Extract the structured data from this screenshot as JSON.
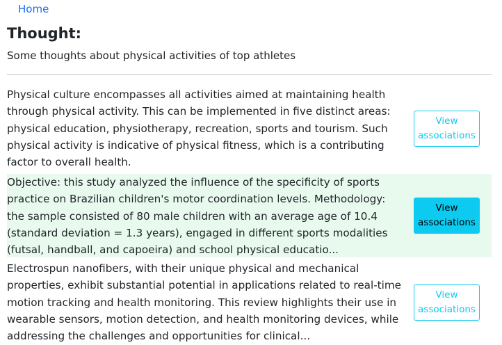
{
  "nav": {
    "home_label": "Home"
  },
  "header": {
    "title": "Thought:",
    "subtitle": "Some thoughts about physical activities of top athletes"
  },
  "items": [
    {
      "text": "Physical culture encompasses all activities aimed at maintaining health through physical activity. This can be implemented in five distinct areas: physical education, physiotherapy, recreation, sports and tourism. Such physical activity is indicative of physical fitness, which is a contributing factor to overall health.",
      "button_line1": "View",
      "button_line2": "associations",
      "highlighted": false
    },
    {
      "text": "Objective: this study analyzed the influence of the specificity of sports practice on Brazilian children's motor coordination levels. Methodology: the sample consisted of 80 male children with an average age of 10.4 (standard deviation = 1.3 years), engaged in different sports modalities (futsal, handball, and capoeira) and school physical educatio...",
      "button_line1": "View",
      "button_line2": "associations",
      "highlighted": true
    },
    {
      "text": "Electrospun nanofibers, with their unique physical and mechanical properties, exhibit substantial potential in applications related to real-time motion tracking and health monitoring. This review highlights their use in wearable sensors, motion detection, and health monitoring devices, while addressing the challenges and opportunities for clinical...",
      "button_line1": "View",
      "button_line2": "associations",
      "highlighted": false
    }
  ],
  "colors": {
    "link": "#0d6efd",
    "button_accent": "#0dcaf0",
    "highlight_row": "#e8faee",
    "divider": "#c8c8c8",
    "text": "#212529"
  }
}
